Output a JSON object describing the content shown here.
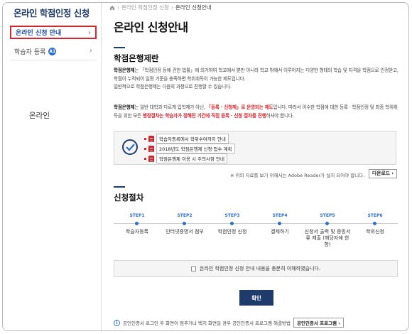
{
  "sidebar": {
    "title": "온라인 학점인정 신청",
    "items": [
      {
        "label": "온라인 신청 안내",
        "chevron": "›"
      },
      {
        "label": "학습자 등록",
        "badge": "A1",
        "chevron": "›"
      }
    ],
    "footer_text": "온라인"
  },
  "breadcrumb": {
    "home_icon": "home-icon",
    "items": [
      "온라인 학점인정 신청",
      "온라인 신청안내"
    ]
  },
  "page_title": "온라인 신청안내",
  "section1": {
    "title": "학점은행제란",
    "para1_term": "학점은행제",
    "para1_rest": "는 「학점인정 등에 관한 법률」에 의거하여 학교에서 뿐만 아니라 학교 밖에서 이루어지는 다양한 형태의 학습 및 자격을 학점으로 인정받고, 학점이 누적되어 일정 기준을 충족하면 학위취득이 가능한 제도입니다.",
    "para2": "일반적으로 학점은행제는 다음의 과정으로 진행할 수 있습니다.",
    "para3_term": "학점은행제",
    "para3_a": "는 일반 대학과 다르게 입학제가 아닌, ",
    "para3_red1": "「등록 · 신청제」로 운영되는 제도",
    "para3_b": "입니다. 따라서 이수한 학점에 대한 등록 · 학점인정 및 최종 학위취득을 위한 모든 ",
    "para3_red2": "행정절차는 학습자가 정해진 기간에 직접 등록 · 신청 절차를 진행",
    "para3_c": "하셔야 합니다."
  },
  "documents": [
    {
      "label": "학습자등록에서 학위수여까지 안내"
    },
    {
      "label": "2018년도 학점은행제 신청·접수 계획"
    },
    {
      "label": "학점은행제 이용 시 주의사항 안내"
    }
  ],
  "adobe_note": "※ 위의 자료를 보기 위해서는 Adobe Reader가 설치 되어야 합니다.",
  "download_label": "다운로드 ›",
  "section2": {
    "title": "신청절차"
  },
  "steps": [
    {
      "no": "STEP1",
      "label": "학습자등록"
    },
    {
      "no": "STEP2",
      "label": "인터넷증명서 첨부"
    },
    {
      "no": "STEP3",
      "label": "학점인정 신청"
    },
    {
      "no": "STEP4",
      "label": "결제하기"
    },
    {
      "no": "STEP5",
      "label": "신청서 출력 및 증빙서류 제출 (해당자에 한함)"
    },
    {
      "no": "STEP6",
      "label": "학위신청"
    }
  ],
  "consent_label": "온라인 학점인정 신청 안내 내용을 충분히 이해하였습니다.",
  "confirm_label": "확인",
  "cert_note": {
    "text": "공인인증서 로그인 후 화면이 멈추거나 백지 화면일 경우 공인인증서 프로그램 해결방법",
    "button": "공인인증서 프로그램 ›"
  },
  "colors": {
    "accent": "#1f3b6b",
    "link": "#2e6fcf",
    "highlight": "#d3272f"
  }
}
